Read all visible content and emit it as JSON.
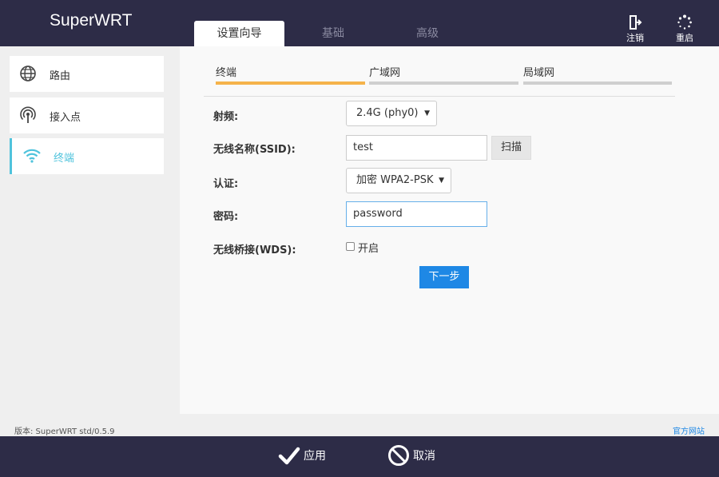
{
  "app": {
    "title": "SuperWRT"
  },
  "header": {
    "tabs": [
      {
        "label": "设置向导",
        "active": true
      },
      {
        "label": "基础",
        "active": false
      },
      {
        "label": "高级",
        "active": false
      }
    ],
    "logout_label": "注销",
    "reboot_label": "重启"
  },
  "sidebar": {
    "items": [
      {
        "label": "路由",
        "icon": "globe-icon",
        "active": false
      },
      {
        "label": "接入点",
        "icon": "access-point-icon",
        "active": false
      },
      {
        "label": "终端",
        "icon": "wifi-icon",
        "active": true
      }
    ]
  },
  "subtabs": [
    {
      "label": "终端",
      "active": true
    },
    {
      "label": "广域网",
      "active": false
    },
    {
      "label": "局域网",
      "active": false
    }
  ],
  "form": {
    "radio_label": "射频:",
    "radio_value": "2.4G (phy0)",
    "ssid_label": "无线名称(SSID):",
    "ssid_value": "test",
    "scan_label": "扫描",
    "auth_label": "认证:",
    "auth_value": "加密 WPA2-PSK",
    "password_label": "密码:",
    "password_value": "password",
    "wds_label": "无线桥接(WDS):",
    "wds_checkbox_label": "开启",
    "wds_enabled": false,
    "next_label": "下一步"
  },
  "footer": {
    "version": "版本: SuperWRT std/0.5.9",
    "site_link": "官方网站"
  },
  "bottombar": {
    "apply_label": "应用",
    "cancel_label": "取消"
  },
  "colors": {
    "header_bg": "#2d2c47",
    "accent_blue": "#1e88e5",
    "active_cyan": "#4fc3dc",
    "subtab_active": "#f5b34a"
  }
}
